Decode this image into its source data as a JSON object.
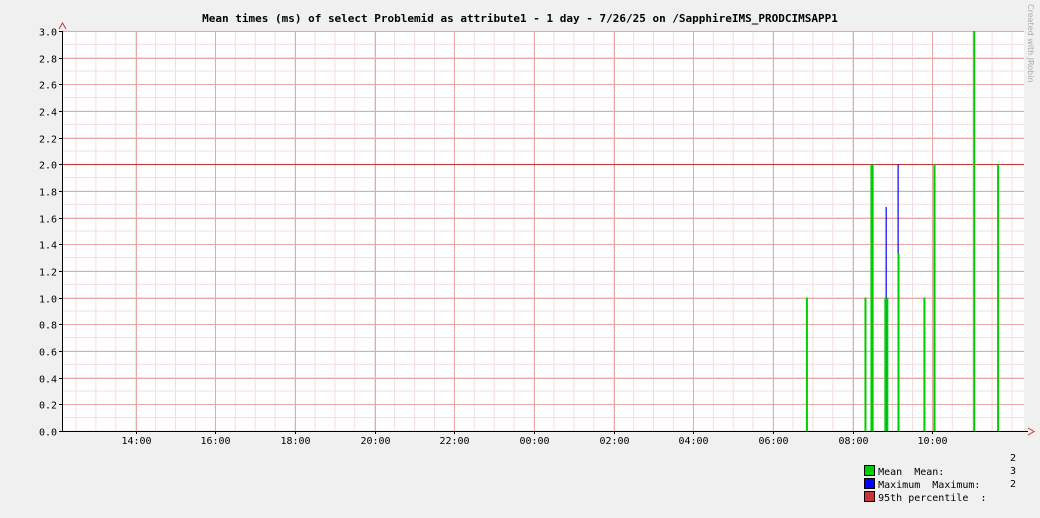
{
  "chart_data": {
    "type": "bar",
    "title": "Mean times (ms) of select Problemid as attribute1 - 1 day - 7/26/25 on /SapphireIMS_PRODCIMSAPP1",
    "xlabel": "",
    "ylabel": "",
    "x_tick_labels": [
      "14:00",
      "16:00",
      "18:00",
      "20:00",
      "22:00",
      "00:00",
      "02:00",
      "04:00",
      "06:00",
      "08:00",
      "10:00"
    ],
    "x_range_hours": [
      12.15,
      36.3
    ],
    "x_tick_hours": [
      14,
      16,
      18,
      20,
      22,
      24,
      26,
      28,
      30,
      32,
      34
    ],
    "ylim": [
      0,
      3.0
    ],
    "y_ticks": [
      "0.0",
      "0.2",
      "0.4",
      "0.6",
      "0.8",
      "1.0",
      "1.2",
      "1.4",
      "1.6",
      "1.8",
      "2.0",
      "2.2",
      "2.4",
      "2.6",
      "2.8",
      "3.0"
    ],
    "grid": true,
    "series": [
      {
        "name": "Mean",
        "color": "#00cc00",
        "points": [
          {
            "x": 30.85,
            "y": 1.0
          },
          {
            "x": 32.32,
            "y": 1.0
          },
          {
            "x": 32.47,
            "y": 2.0
          },
          {
            "x": 32.5,
            "y": 2.0
          },
          {
            "x": 32.82,
            "y": 1.0
          },
          {
            "x": 32.87,
            "y": 1.0
          },
          {
            "x": 33.15,
            "y": 1.33
          },
          {
            "x": 33.8,
            "y": 1.0
          },
          {
            "x": 34.05,
            "y": 2.0
          },
          {
            "x": 35.05,
            "y": 3.0
          },
          {
            "x": 35.65,
            "y": 2.0
          }
        ]
      },
      {
        "name": "Maximum",
        "color": "#0000ff",
        "points": [
          {
            "x": 32.47,
            "y": 2.0
          },
          {
            "x": 32.5,
            "y": 2.0
          },
          {
            "x": 32.84,
            "y": 1.68
          },
          {
            "x": 33.14,
            "y": 2.0
          },
          {
            "x": 34.06,
            "y": 2.0
          },
          {
            "x": 35.05,
            "y": 3.0
          }
        ]
      },
      {
        "name": "95th percentile",
        "color": "#cc3333",
        "points": [
          {
            "x": 35.05,
            "y": 3.0
          }
        ]
      }
    ],
    "percentile_line": {
      "name": "95th percentile",
      "y": 2.0,
      "color": "#cc3333"
    }
  },
  "legend": [
    {
      "name": "Mean",
      "label": "Mean  Mean:",
      "value": "2",
      "color": "#00cc00"
    },
    {
      "name": "Maximum",
      "label": "Maximum  Maximum:",
      "value": "3",
      "color": "#0000ff"
    },
    {
      "name": "95th percentile",
      "label": "95th percentile  :",
      "value": "2",
      "color": "#cc3333"
    }
  ],
  "watermark": "Created with JRobin"
}
